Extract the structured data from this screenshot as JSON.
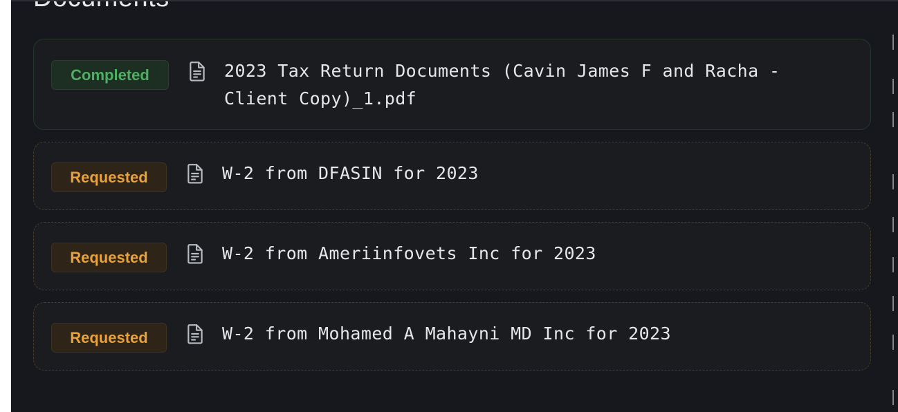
{
  "section": {
    "title": "Documents"
  },
  "documents": [
    {
      "status": "Completed",
      "title": "2023 Tax Return Documents (Cavin James F and Racha - Client Copy)_1.pdf",
      "icon": "file-text-icon"
    },
    {
      "status": "Requested",
      "title": "W-2 from DFASIN for 2023",
      "icon": "file-text-icon"
    },
    {
      "status": "Requested",
      "title": "W-2 from Ameriinfovets Inc for 2023",
      "icon": "file-text-icon"
    },
    {
      "status": "Requested",
      "title": "W-2 from Mohamed A Mahayni MD Inc for 2023",
      "icon": "file-text-icon"
    }
  ],
  "colors": {
    "panel_background": "#16181d",
    "completed_text": "#4caf62",
    "requested_text": "#e9a23b",
    "title_text": "#e6e6e8"
  }
}
